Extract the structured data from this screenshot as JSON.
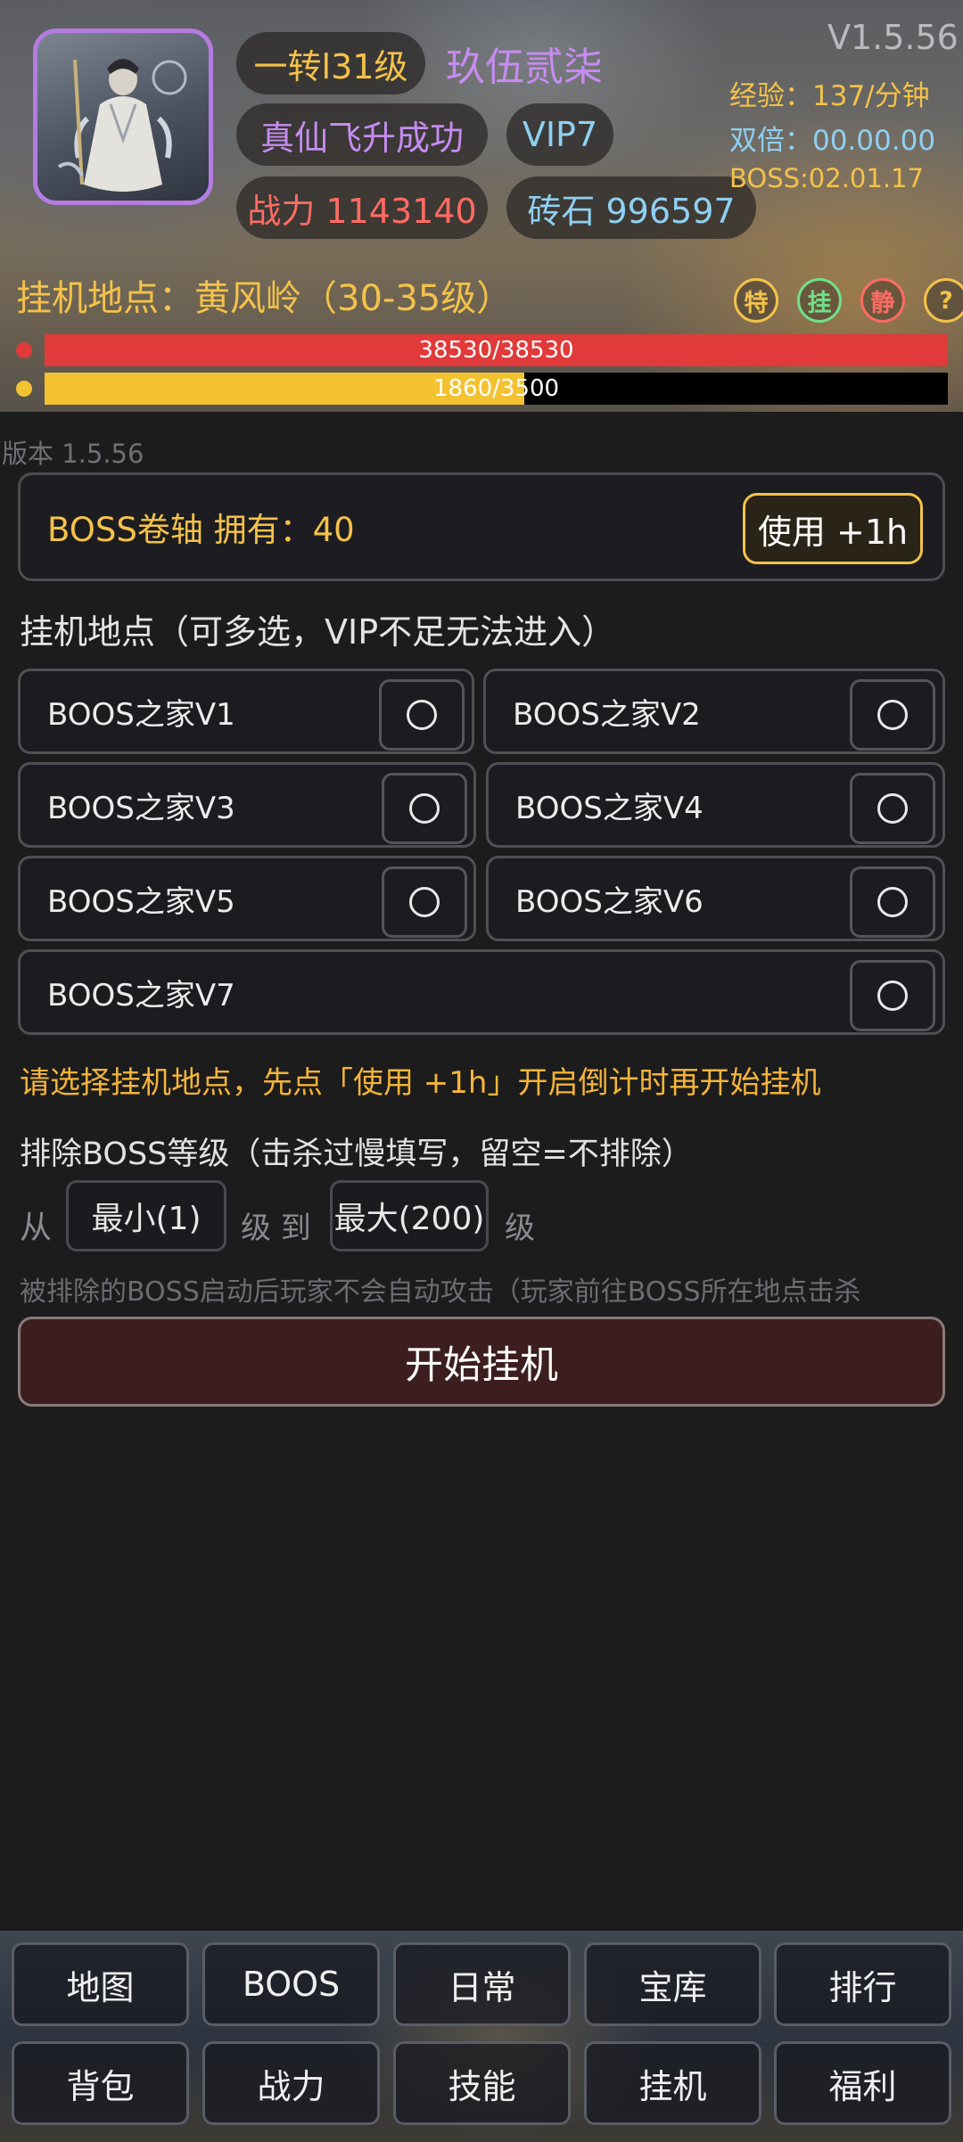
{
  "header": {
    "version_top": "V1.5.56",
    "level": "一转l31级",
    "player_name": "玖伍贰柒",
    "status": "真仙飞升成功",
    "vip": "VIP7",
    "power": "战力 1143140",
    "bricks": "砖石 996597",
    "exp": "经验：137/分钟",
    "double": "双倍：00.00.00",
    "boss_timer": "BOSS:02.01.17",
    "location": "挂机地点：黄风岭（30-35级）",
    "icons": [
      {
        "label": "特",
        "name": "special-icon",
        "color": "#f4c24a"
      },
      {
        "label": "挂",
        "name": "idle-icon",
        "color": "#6fe08a"
      },
      {
        "label": "静",
        "name": "silent-icon",
        "color": "#ff6b63"
      },
      {
        "label": "?",
        "name": "help-icon",
        "color": "#f4c24a"
      }
    ],
    "hp": {
      "text": "38530/38530",
      "current": 38530,
      "max": 38530,
      "color": "#e03a3a"
    },
    "mp": {
      "text": "1860/3500",
      "current": 1860,
      "max": 3500,
      "color": "#f2c230"
    }
  },
  "main": {
    "version": "版本 1.5.56",
    "scroll": {
      "label": "BOSS卷轴 拥有：40",
      "button": "使用 +1h"
    },
    "locations_title": "挂机地点（可多选，VIP不足无法进入）",
    "locations": [
      "BOOS之家V1",
      "BOOS之家V2",
      "BOOS之家V3",
      "BOOS之家V4",
      "BOOS之家V5",
      "BOOS之家V6",
      "BOOS之家V7"
    ],
    "hint": "请选择挂机地点，先点「使用 +1h」开启倒计时再开始挂机",
    "exclude_title": "排除BOSS等级（击杀过慢填写，留空=不排除）",
    "from_label": "从",
    "min_placeholder": "最小(1)",
    "to_label": "级 到",
    "max_placeholder": "最大(200)",
    "unit_label": "级",
    "note": "被排除的BOSS启动后玩家不会自动攻击（玩家前往BOSS所在地点击杀",
    "start_button": "开始挂机"
  },
  "nav": {
    "row1": [
      "地图",
      "BOOS",
      "日常",
      "宝库",
      "排行"
    ],
    "row2": [
      "背包",
      "战力",
      "技能",
      "挂机",
      "福利"
    ]
  }
}
